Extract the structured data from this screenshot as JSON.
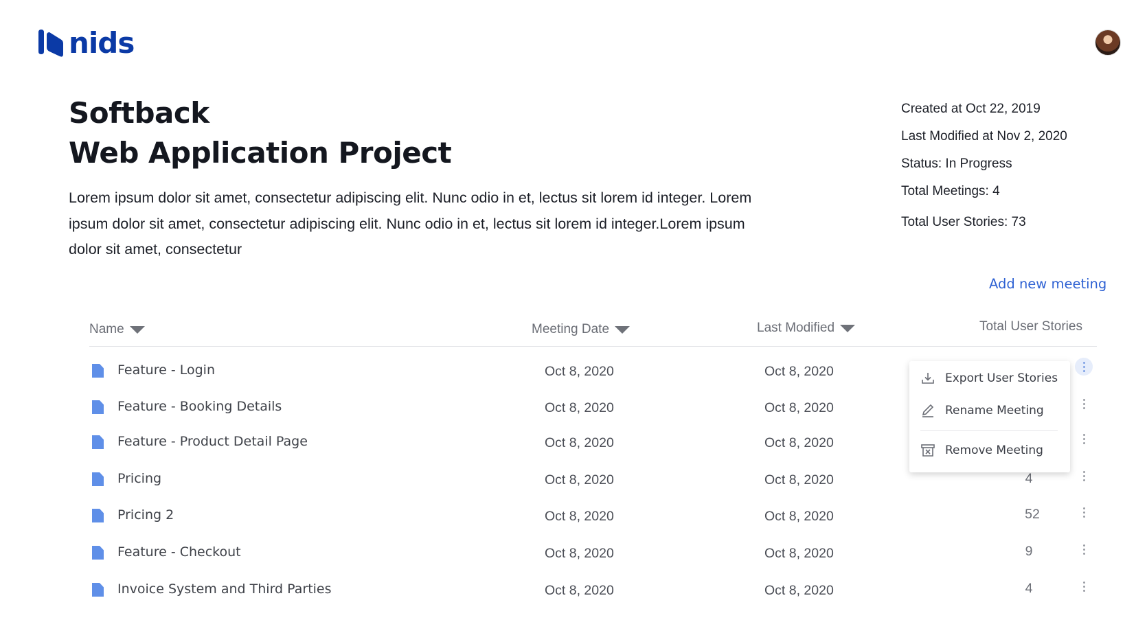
{
  "brand": {
    "name": "nids",
    "color": "#0b3aa6"
  },
  "user": {
    "avatar_icon": "user-avatar"
  },
  "project": {
    "title_line1": "Softback",
    "title_line2": "Web Application Project",
    "description": "Lorem ipsum dolor sit amet, consectetur adipiscing elit. Nunc odio in et, lectus sit lorem id integer. Lorem ipsum dolor sit amet, consectetur adipiscing elit. Nunc odio in et, lectus sit lorem id integer.Lorem ipsum dolor sit amet, consectetur"
  },
  "meta": {
    "created": "Created at Oct 22, 2019",
    "modified": "Last Modified at Nov 2, 2020",
    "status": "Status: In Progress",
    "meetings": "Total Meetings: 4",
    "stories": "Total User Stories: 73"
  },
  "actions": {
    "add_meeting": "Add new meeting",
    "accent": "#2f62d3"
  },
  "table": {
    "headers": {
      "name": "Name",
      "meeting_date": "Meeting Date",
      "last_modified": "Last Modified",
      "total_stories": "Total User Stories"
    },
    "rows": [
      {
        "name": "Feature - Login",
        "meeting_date": "Oct 8, 2020",
        "last_modified": "Oct 8, 2020",
        "stories": ""
      },
      {
        "name": "Feature - Booking Details",
        "meeting_date": "Oct 8, 2020",
        "last_modified": "Oct 8, 2020",
        "stories": ""
      },
      {
        "name": "Feature - Product Detail Page",
        "meeting_date": "Oct 8, 2020",
        "last_modified": "Oct 8, 2020",
        "stories": ""
      },
      {
        "name": "Pricing",
        "meeting_date": "Oct 8, 2020",
        "last_modified": "Oct 8, 2020",
        "stories": "4"
      },
      {
        "name": "Pricing 2",
        "meeting_date": "Oct 8, 2020",
        "last_modified": "Oct 8, 2020",
        "stories": "52"
      },
      {
        "name": "Feature - Checkout",
        "meeting_date": "Oct 8, 2020",
        "last_modified": "Oct 8, 2020",
        "stories": "9"
      },
      {
        "name": "Invoice System and Third Parties",
        "meeting_date": "Oct 8, 2020",
        "last_modified": "Oct 8, 2020",
        "stories": "4"
      }
    ]
  },
  "context_menu": {
    "export": "Export User Stories",
    "rename": "Rename Meeting",
    "remove": "Remove Meeting"
  }
}
